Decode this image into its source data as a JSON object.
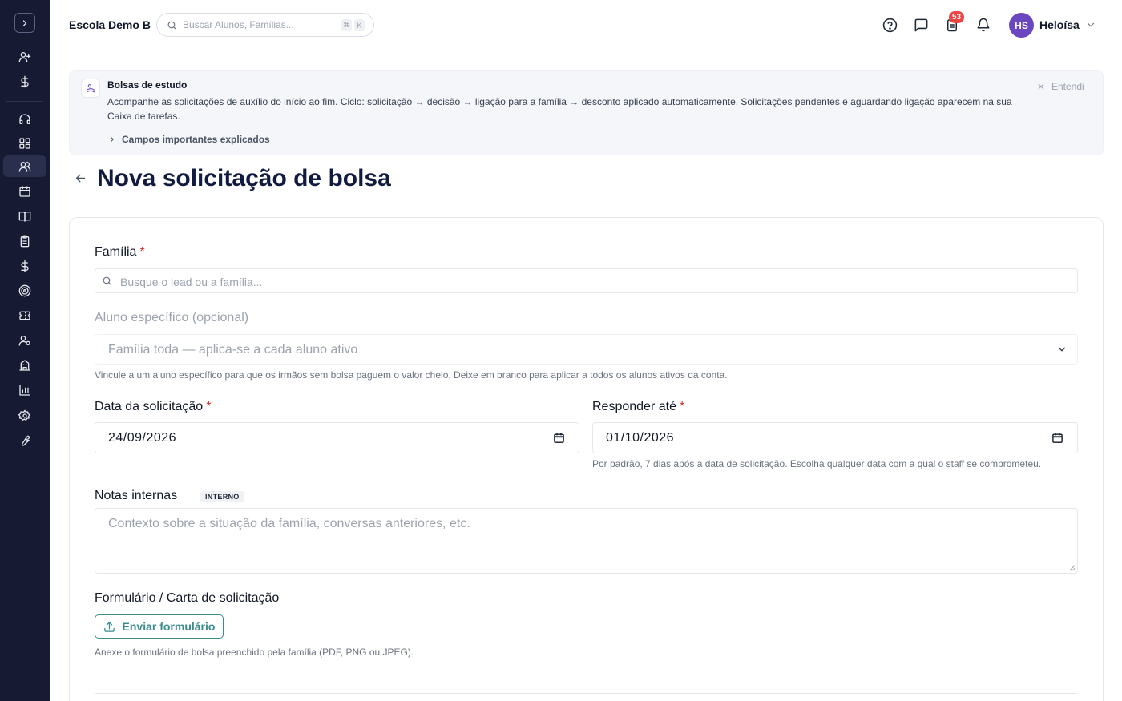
{
  "header": {
    "school_name": "Escola Demo B",
    "search_placeholder": "Buscar Alunos, Famílias...",
    "kbd_1": "⌘",
    "kbd_2": "K",
    "tasks_badge": "53",
    "user_initials": "HS",
    "user_name": "Heloísa"
  },
  "sidebar": {
    "items": [
      "toggle",
      "add-user",
      "dollar",
      "headset",
      "dashboard",
      "people",
      "calendar",
      "book",
      "clipboard",
      "dollar-2",
      "target",
      "ticket",
      "user-settings",
      "building",
      "bar-chart",
      "gear",
      "wrench"
    ]
  },
  "banner": {
    "title": "Bolsas de estudo",
    "text": "Acompanhe as solicitações de auxílio do início ao fim. Ciclo: solicitação → decisão → ligação para a família → desconto aplicado automaticamente. Solicitações pendentes e aguardando ligação aparecem na sua Caixa de tarefas.",
    "dismiss": "Entendi",
    "details_link": "Campos importantes explicados"
  },
  "page": {
    "title": "Nova solicitação de bolsa"
  },
  "form": {
    "family_label": "Família",
    "family_required": "*",
    "family_placeholder": "Busque o lead ou a família...",
    "student_label": "Aluno específico (opcional)",
    "student_value": "Família toda — aplica-se a cada aluno ativo",
    "student_help": "Vincule a um aluno específico para que os irmãos sem bolsa paguem o valor cheio. Deixe em branco para aplicar a todos os alunos ativos da conta.",
    "request_date_label": "Data da solicitação",
    "request_date_required": "*",
    "request_date_value": "24/09/2026",
    "respond_by_label": "Responder até",
    "respond_by_required": "*",
    "respond_by_value": "01/10/2026",
    "respond_by_help": "Por padrão, 7 dias após a data de solicitação. Escolha qualquer data com a qual o staff se comprometeu.",
    "notes_label": "Notas internas",
    "notes_chip": "INTERNO",
    "notes_placeholder": "Contexto sobre a situação da família, conversas anteriores, etc.",
    "form_label": "Formulário / Carta de solicitação",
    "upload_button": "Enviar formulário",
    "upload_help": "Anexe o formulário de bolsa preenchido pela família (PDF, PNG ou JPEG)."
  },
  "colors": {
    "sidebar_bg": "#161a33",
    "accent": "#3a8c8c",
    "avatar": "#6b46c1",
    "badge": "#ef4444",
    "required": "#dc2626"
  }
}
